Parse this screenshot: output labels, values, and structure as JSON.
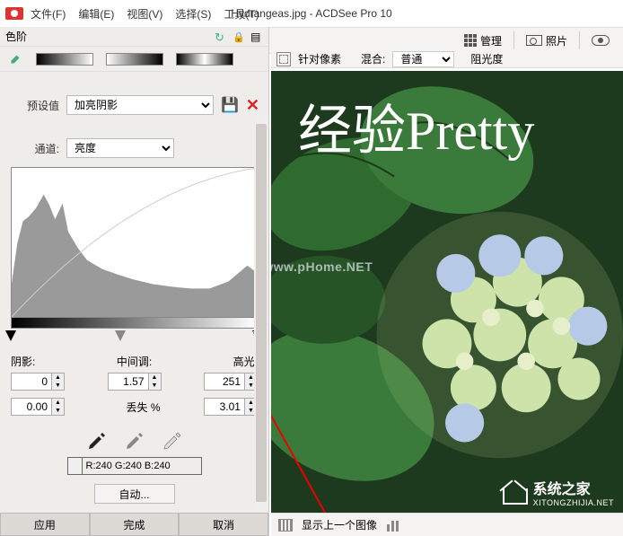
{
  "app": {
    "title": "Hydrangeas.jpg - ACDSee Pro 10",
    "menus": [
      "文件(F)",
      "编辑(E)",
      "视图(V)",
      "选择(S)",
      "工具(T)"
    ]
  },
  "toolbar": {
    "manage": "管理",
    "photos": "照片"
  },
  "view_tools": {
    "pixel_target": "针对像素",
    "blend_label": "混合:",
    "blend_value": "普通",
    "opacity_label": "阻光度"
  },
  "sidebar": {
    "panel_title": "色阶",
    "preset_label": "预设值",
    "preset_value": "加亮阴影",
    "channel_label": "通道:",
    "channel_value": "亮度",
    "shadow_label": "阴影:",
    "midtone_label": "中间调:",
    "highlight_label": "高光:",
    "shadow_val": "0",
    "midtone_val": "1.57",
    "highlight_val": "251",
    "extra_left": "0.00",
    "lose_label": "丢失  %",
    "extra_right": "3.01",
    "rgb_readout": "R:240  G:240  B:240",
    "auto_btn": "自动...",
    "apply": "应用",
    "done": "完成",
    "cancel": "取消"
  },
  "canvas": {
    "overlay_text": "经验Pretty",
    "wm2": "wwww.pHome.NET",
    "logo_main": "系统之家",
    "logo_sub": "XITONGZHIJIA.NET"
  },
  "bottom_bar": {
    "prev_label": "显示上一个图像"
  }
}
